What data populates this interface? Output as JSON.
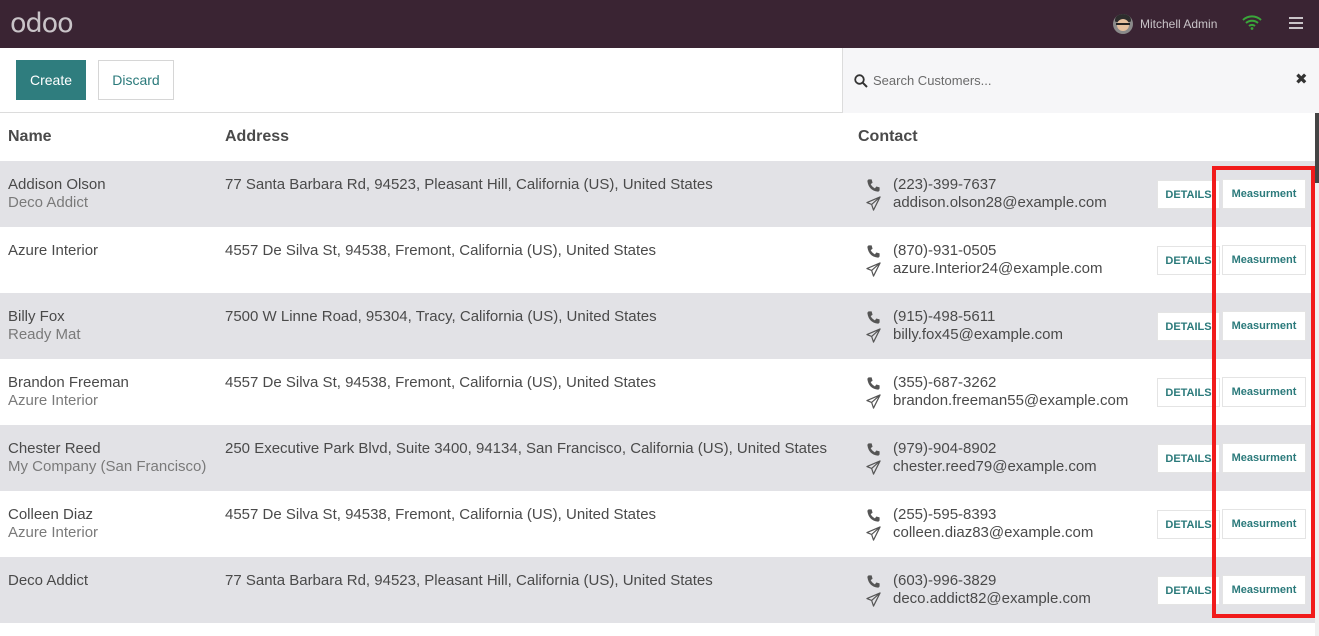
{
  "app": {
    "logo": "odoo"
  },
  "topbar": {
    "user_name": "Mitchell Admin"
  },
  "toolbar": {
    "create_label": "Create",
    "discard_label": "Discard"
  },
  "search": {
    "placeholder": "Search Customers...",
    "clear_label": "✖"
  },
  "table": {
    "headers": {
      "name": "Name",
      "address": "Address",
      "contact": "Contact"
    },
    "details_label": "DETAILS",
    "measurement_label": "Measurment",
    "rows": [
      {
        "name": "Addison Olson",
        "company": "Deco Addict",
        "address": "77 Santa Barbara Rd, 94523, Pleasant Hill, California (US), United States",
        "phone": "(223)-399-7637",
        "email": "addison.olson28@example.com"
      },
      {
        "name": "Azure Interior",
        "company": "",
        "address": "4557 De Silva St, 94538, Fremont, California (US), United States",
        "phone": "(870)-931-0505",
        "email": "azure.Interior24@example.com"
      },
      {
        "name": "Billy Fox",
        "company": "Ready Mat",
        "address": "7500 W Linne Road, 95304, Tracy, California (US), United States",
        "phone": "(915)-498-5611",
        "email": "billy.fox45@example.com"
      },
      {
        "name": "Brandon Freeman",
        "company": "Azure Interior",
        "address": "4557 De Silva St, 94538, Fremont, California (US), United States",
        "phone": "(355)-687-3262",
        "email": "brandon.freeman55@example.com"
      },
      {
        "name": "Chester Reed",
        "company": "My Company (San Francisco)",
        "address": "250 Executive Park Blvd, Suite 3400, 94134, San Francisco, California (US), United States",
        "phone": "(979)-904-8902",
        "email": "chester.reed79@example.com"
      },
      {
        "name": "Colleen Diaz",
        "company": "Azure Interior",
        "address": "4557 De Silva St, 94538, Fremont, California (US), United States",
        "phone": "(255)-595-8393",
        "email": "colleen.diaz83@example.com"
      },
      {
        "name": "Deco Addict",
        "company": "",
        "address": "77 Santa Barbara Rd, 94523, Pleasant Hill, California (US), United States",
        "phone": "(603)-996-3829",
        "email": "deco.addict82@example.com"
      }
    ]
  },
  "colors": {
    "topbar": "#3a2433",
    "primary": "#2f7d7e",
    "highlight": "#f11b1b",
    "row_alt": "#e2e2e6"
  },
  "icons": {
    "phone": "phone-icon",
    "email": "paper-plane-icon",
    "search": "search-icon",
    "menu": "hamburger-menu-icon",
    "wifi": "wifi-icon"
  }
}
